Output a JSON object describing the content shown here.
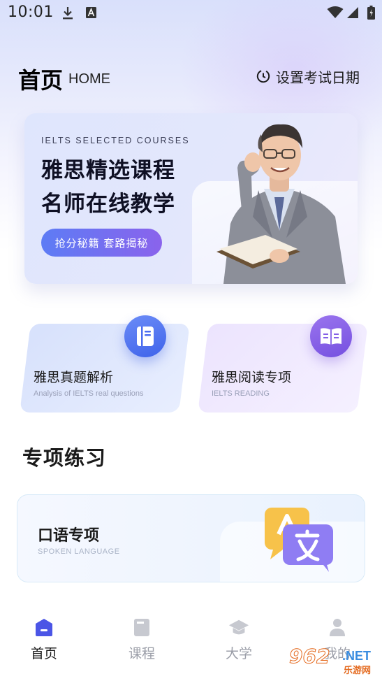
{
  "status_bar": {
    "time": "10:01",
    "icons": [
      "download-icon",
      "a-badge-icon",
      "wifi-icon",
      "signal-icon",
      "battery-icon"
    ]
  },
  "header": {
    "title": "首页",
    "subtitle": "HOME",
    "exam_date_label": "设置考试日期",
    "exam_date_icon": "clock-icon"
  },
  "banner": {
    "en_text": "IELTS SELECTED COURSES",
    "line1": "雅思精选课程",
    "line2": "名师在线教学",
    "button_label": "抢分秘籍 套路揭秘"
  },
  "categories": [
    {
      "title": "雅思真题解析",
      "subtitle": "Analysis of IELTS real questions",
      "icon": "notebook-icon",
      "color": "#4a6cf0"
    },
    {
      "title": "雅思阅读专项",
      "subtitle": "IELTS READING",
      "icon": "open-book-icon",
      "color": "#8460e6"
    }
  ],
  "section": {
    "title": "专项练习"
  },
  "spoken": {
    "title": "口语专项",
    "subtitle": "SPOKEN LANGUAGE",
    "icon": "chat-bubbles-icon"
  },
  "bottom_nav": [
    {
      "label": "首页",
      "icon": "home-icon",
      "active": true
    },
    {
      "label": "课程",
      "icon": "book-icon",
      "active": false
    },
    {
      "label": "大学",
      "icon": "graduation-cap-icon",
      "active": false
    },
    {
      "label": "我的",
      "icon": "person-icon",
      "active": false
    }
  ],
  "watermark": {
    "number": "962",
    "suffix": ".NET",
    "cn": "乐游网"
  },
  "colors": {
    "accent_blue": "#4a6cf0",
    "accent_purple": "#8460e6",
    "nav_active": "#4b55e6",
    "nav_inactive": "#c7c9d0"
  }
}
